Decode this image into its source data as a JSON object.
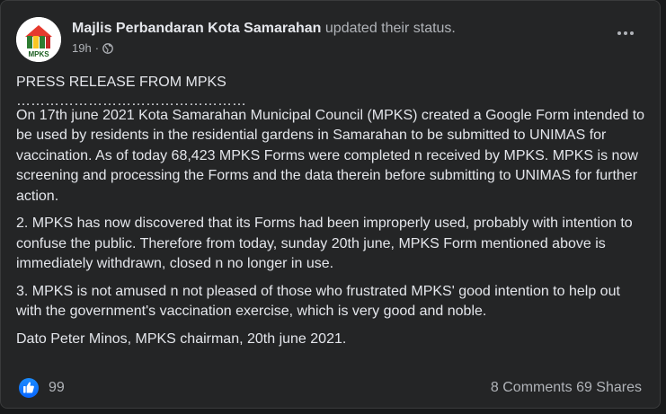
{
  "post": {
    "author": "Majlis Perbandaran Kota Samarahan",
    "action": "updated their status.",
    "time": "19h",
    "separator": "·",
    "avatar_text": "MPKS",
    "paragraphs": [
      "PRESS RELEASE FROM MPKS",
      "…………………………………………",
      "On 17th june 2021 Kota Samarahan Municipal Council (MPKS) created a Google Form intended to be used by residents in the residential gardens in Samarahan to be submitted to UNIMAS for vaccination. As of today 68,423 MPKS Forms were completed n received by MPKS. MPKS is now screening and processing the Forms and the data therein before submitting to UNIMAS for further action.",
      "2. MPKS has now discovered that its Forms had been improperly used, probably with intention to confuse the public. Therefore from today, sunday 20th june, MPKS  Form mentioned above is immediately withdrawn, closed n no longer in use.",
      "3. MPKS is not amused n not pleased of those who frustrated MPKS' good intention to help out with the  government's vaccination exercise, which is very good and noble.",
      "Dato Peter Minos, MPKS chairman, 20th june 2021."
    ]
  },
  "footer": {
    "reactions": "99",
    "comments": "8 Comments",
    "shares": "69 Shares"
  },
  "colors": {
    "background": "#18191a",
    "card": "#242526",
    "text_primary": "#e4e6eb",
    "text_secondary": "#b0b3b8",
    "like_blue": "#0866ff"
  },
  "icons": [
    "globe-icon",
    "more-icon",
    "like-icon"
  ]
}
